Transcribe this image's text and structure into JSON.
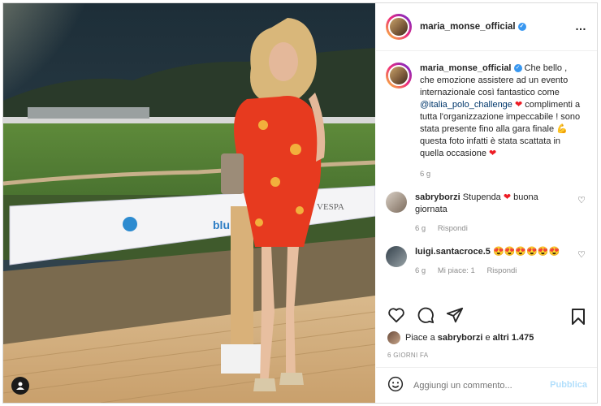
{
  "post": {
    "username": "maria_monse_official",
    "verified_badge": "✓",
    "more_icon": "…",
    "caption": {
      "username": "maria_monse_official",
      "text_1": "Che bello , che emozione assistere ad un evento internazionale così fantastico come",
      "mention": "@italia_polo_challenge",
      "text_2": "complimenti a tutta l'organizzazione impeccabile ! sono stata presente fino alla gara finale",
      "text_3": "questa foto infatti è stata scattata in quella occasione",
      "time": "6 g"
    },
    "comments": [
      {
        "username": "sabryborzi",
        "text": "Stupenda",
        "text_after": "buona giornata",
        "time": "6 g",
        "reply": "Rispondi"
      },
      {
        "username": "luigi.santacroce.5",
        "emojis": "😍😍😍😍😍😍",
        "time": "6 g",
        "likes": "Mi piace: 1",
        "reply": "Rispondi"
      }
    ],
    "likes_text": "Piace a",
    "likes_user": "sabryborzi",
    "likes_and": "e",
    "likes_others": "altri 1.475",
    "date": "6 GIORNI FA",
    "add_comment_placeholder": "Aggiungi un commento...",
    "publish_label": "Pubblica",
    "heart_emoji": "❤",
    "muscle_emoji": "💪"
  },
  "media": {
    "banner_text": "VESPA",
    "sponsor_text": "blu"
  }
}
